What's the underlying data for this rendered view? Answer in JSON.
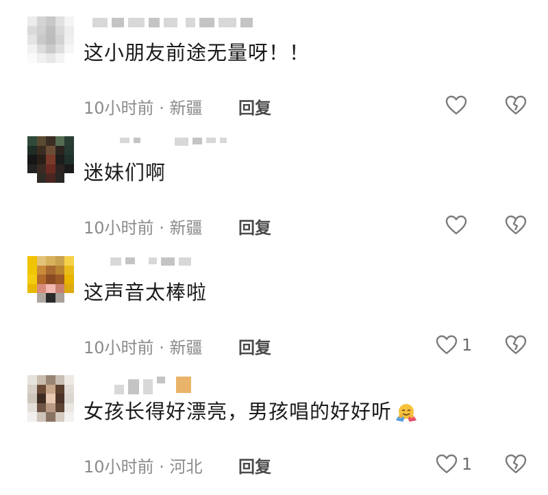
{
  "comments": [
    {
      "text": "这小朋友前途无量呀！！",
      "time": "10小时前",
      "location": "新疆",
      "reply": "回复",
      "likes": "",
      "avatar_colors": [
        "#ececec",
        "#d4d4d4",
        "#c8c8c8",
        "#e0e0e0",
        "#f4f4f4",
        "#dadada",
        "#cfcfcf",
        "#bebebe",
        "#d9d9d9",
        "#ededed",
        "#e4e4e4",
        "#c9c9c9",
        "#bcbcbc",
        "#d2d2d2",
        "#f0f0f0",
        "#f2f2f2",
        "#dcdcdc",
        "#cacaca",
        "#dedede",
        "#f6f6f6",
        "#fafafa",
        "#f0f0f0",
        "#e8e8e8",
        "#f4f4f4",
        "#ffffff"
      ]
    },
    {
      "text": "迷妹们啊",
      "time": "10小时前",
      "location": "新疆",
      "reply": "回复",
      "likes": "",
      "avatar_colors": [
        "#2f4a3a",
        "#5a4a32",
        "#3a2e22",
        "#556b52",
        "#2a3d33",
        "#1e2d26",
        "#3b2c22",
        "#6b4d36",
        "#2b241e",
        "#243a30",
        "#161616",
        "#2a1e18",
        "#7a3a2a",
        "#1c1c1c",
        "#20302a",
        "#222222",
        "#3a2a22",
        "#6a2a22",
        "#2c2420",
        "#1a1a1a",
        "#ffffff",
        "#2e2a26",
        "#4a2620",
        "#2a2624",
        "#ffffff"
      ]
    },
    {
      "text": "这声音太棒啦",
      "time": "10小时前",
      "location": "新疆",
      "reply": "回复",
      "likes": "1",
      "avatar_colors": [
        "#f2c200",
        "#e3c27a",
        "#d7b15c",
        "#c9a250",
        "#f6d24a",
        "#efc600",
        "#c98a3a",
        "#a86a30",
        "#b8842f",
        "#e9bb1a",
        "#f4cc10",
        "#b26a2a",
        "#8a4a22",
        "#9c5a26",
        "#e8b400",
        "#e8b800",
        "#d88a7a",
        "#f0b8b0",
        "#c78070",
        "#ddaa10",
        "#ffffff",
        "#b0a8a0",
        "#2a2a2a",
        "#a8a098",
        "#ffffff"
      ]
    },
    {
      "text": "女孩长得好漂亮，男孩唱的好好听",
      "time": "10小时前",
      "location": "河北",
      "reply": "回复",
      "likes": "1",
      "avatar_colors": [
        "#e6e2dc",
        "#c9bcae",
        "#9a8472",
        "#c8beb2",
        "#eeeae6",
        "#d8d0c6",
        "#6a4a36",
        "#c8a88c",
        "#5a3e2e",
        "#e2dcd6",
        "#cfc6bc",
        "#3e2a20",
        "#e8c8b0",
        "#4a3226",
        "#dcd6d0",
        "#e4ded8",
        "#6e5444",
        "#b89a84",
        "#5e4434",
        "#eae6e2",
        "#f2f0ee",
        "#cfc4ba",
        "#8a7262",
        "#d4cac0",
        "#f4f2f0"
      ]
    }
  ],
  "separator": "·",
  "icons": {
    "like": "heart-outline-icon",
    "dislike": "broken-heart-icon",
    "emoji": "hugging-face-emoji"
  }
}
